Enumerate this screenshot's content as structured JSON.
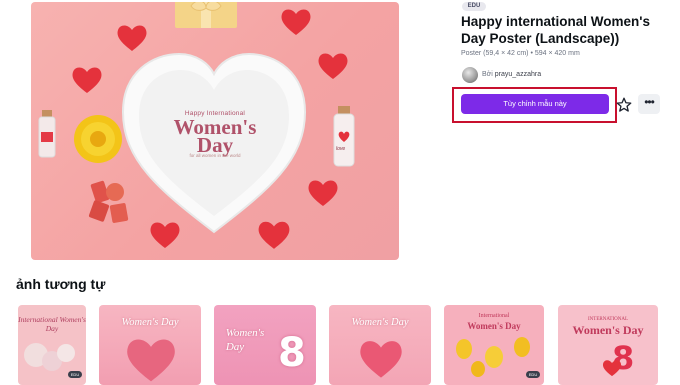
{
  "preview": {
    "plate_small_title": "Happy International",
    "plate_main_title_line1": "Women's",
    "plate_main_title_line2": "Day",
    "plate_subtitle": "for all women in the world",
    "jar_label": "love"
  },
  "detail": {
    "badge": "EDU",
    "title": "Happy international Women's Day Poster (Landscape))",
    "meta": "Poster (59,4 × 42 cm) • 594 × 420 mm",
    "author_prefix": "Bởi",
    "author_name": "prayu_azzahra",
    "cta_label": "Tùy chỉnh mẫu này",
    "more_label": "•••"
  },
  "similar": {
    "heading": "ảnh tương tự",
    "items": [
      {
        "title": "International Women's Day",
        "badge": "EDU"
      },
      {
        "title": "Women's Day"
      },
      {
        "title_line1": "Women's",
        "title_line2": "Day",
        "number": "8"
      },
      {
        "title": "Women's Day"
      },
      {
        "title_line1": "International",
        "title_line2": "Women's Day",
        "badge": "EDU"
      },
      {
        "title_small": "INTERNATIONAL",
        "title": "Women's Day",
        "number": "8"
      }
    ]
  },
  "colors": {
    "accent": "#7d2ae8",
    "highlight_border": "#c8102e",
    "background_pink": "#f4a3a3"
  }
}
